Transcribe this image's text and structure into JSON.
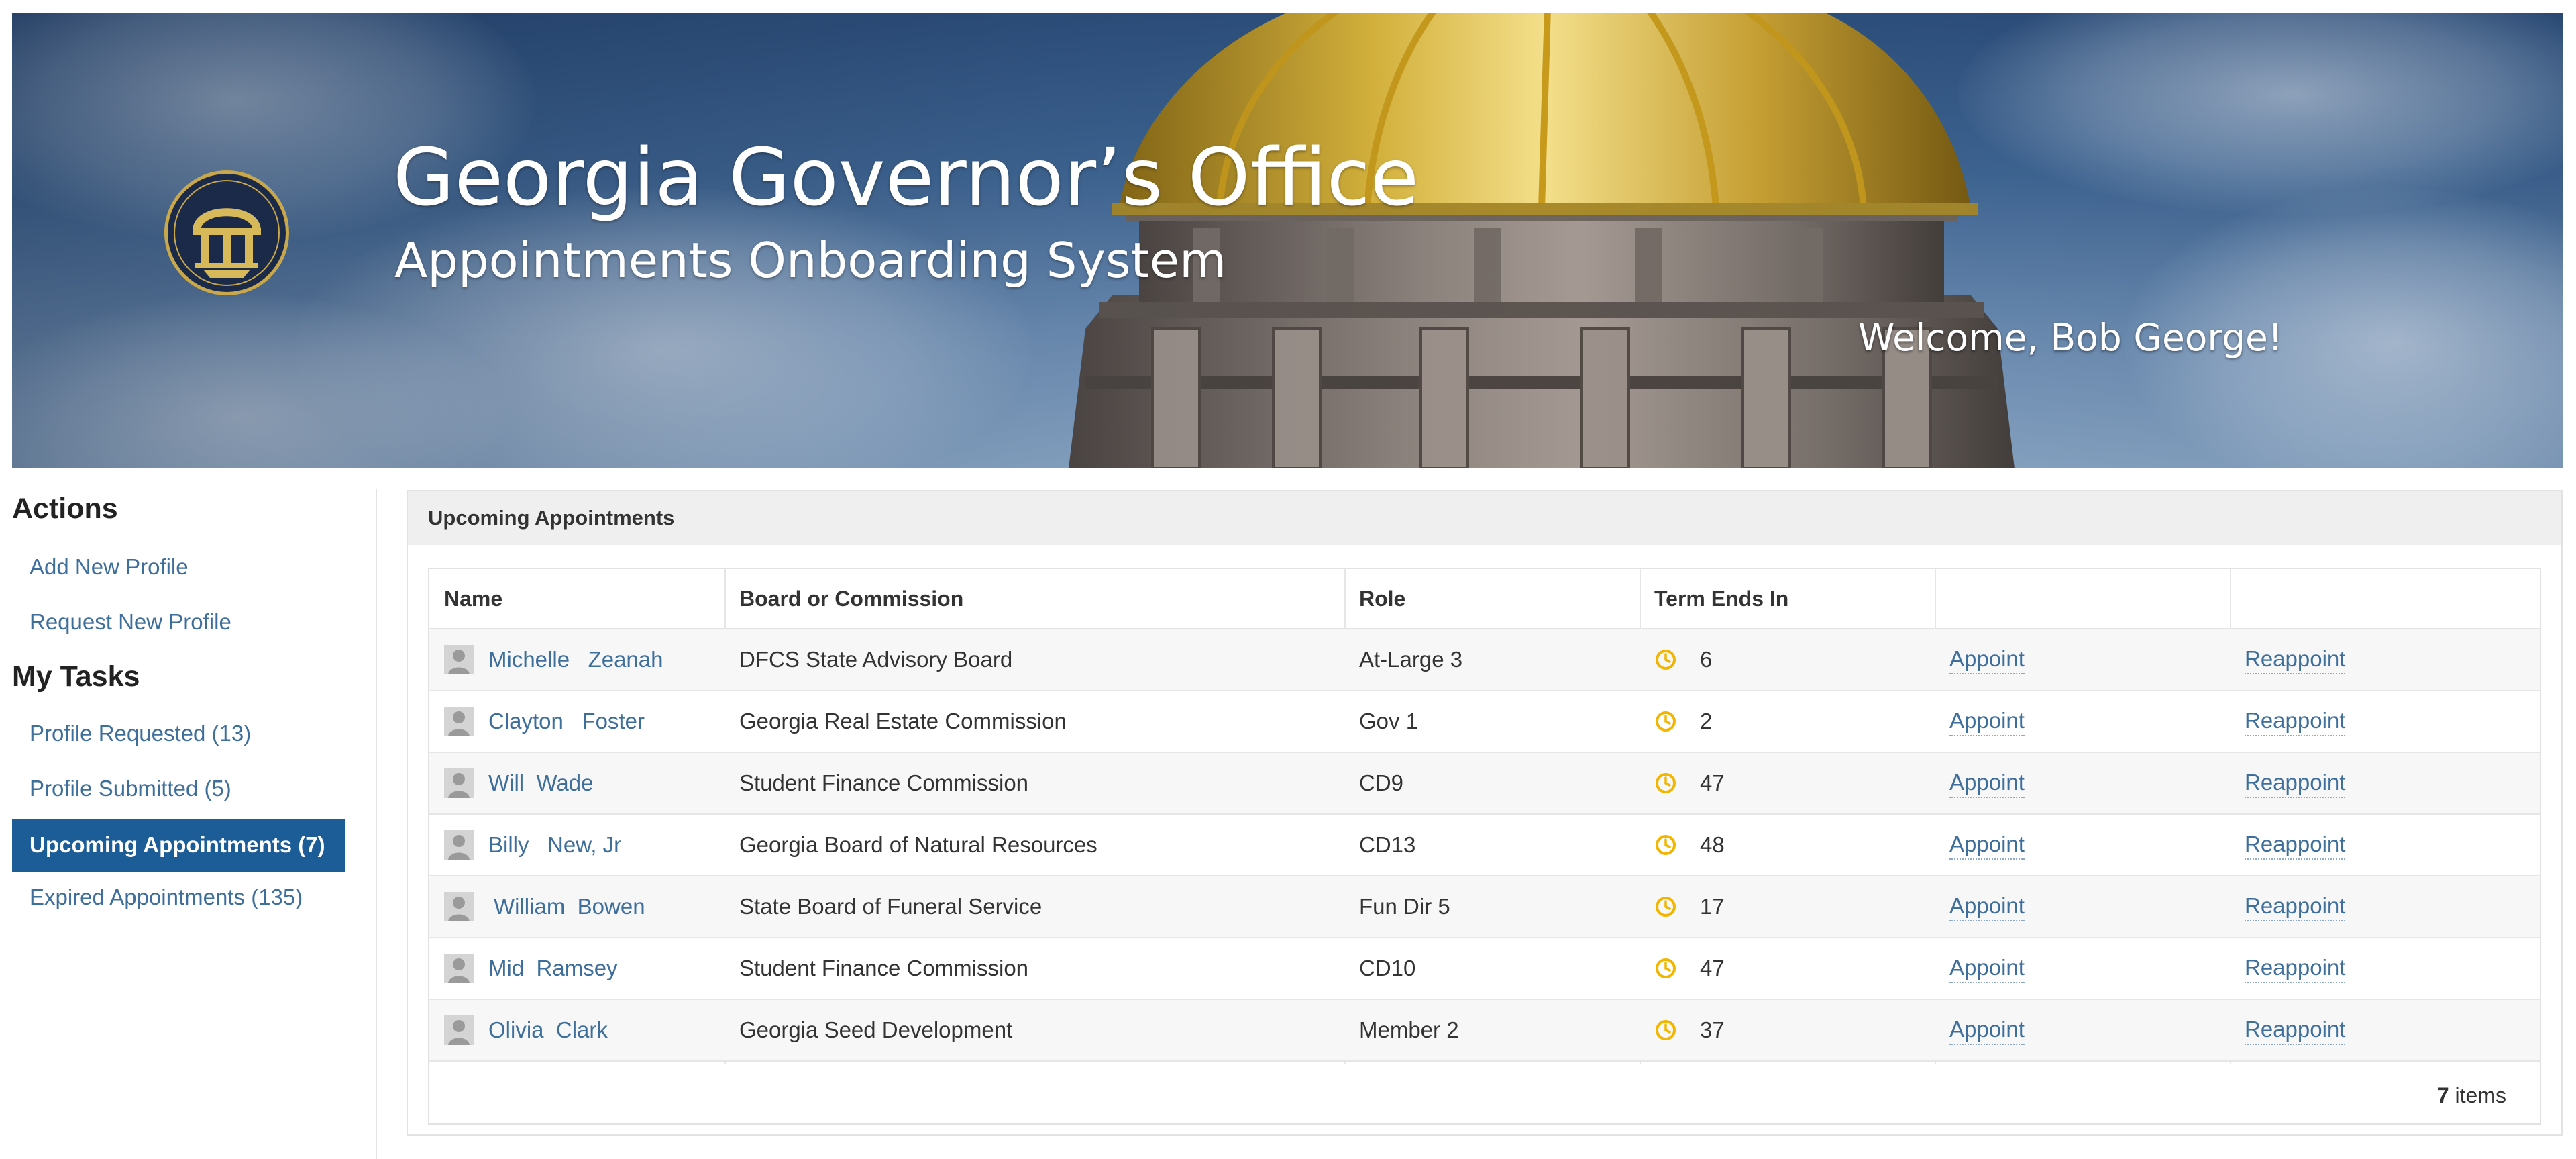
{
  "banner": {
    "title": "Georgia Governor’s Office",
    "subtitle": "Appointments Onboarding System",
    "welcome": "Welcome, Bob George!"
  },
  "sidebar": {
    "actions_heading": "Actions",
    "actions": [
      {
        "label": "Add New Profile"
      },
      {
        "label": "Request New Profile"
      }
    ],
    "tasks_heading": "My Tasks",
    "tasks": [
      {
        "label": "Profile Requested (13)",
        "active": false
      },
      {
        "label": "Profile Submitted (5)",
        "active": false
      },
      {
        "label": "Upcoming Appointments (7)",
        "active": true
      },
      {
        "label": "Expired Appointments (135)",
        "active": false
      }
    ]
  },
  "panel": {
    "title": "Upcoming Appointments",
    "columns": [
      "Name",
      "Board or Commission",
      "Role",
      "Term Ends In",
      "",
      ""
    ],
    "rows": [
      {
        "first": "Michelle",
        "last": "Zeanah",
        "board": "DFCS State Advisory Board",
        "role": "At-Large 3",
        "term": "6",
        "appoint": "Appoint",
        "reappoint": "Reappoint"
      },
      {
        "first": "Clayton",
        "last": "Foster",
        "board": "Georgia Real Estate Commission",
        "role": "Gov 1",
        "term": "2",
        "appoint": "Appoint",
        "reappoint": "Reappoint"
      },
      {
        "first": "Will",
        "last": "Wade",
        "board": "Student Finance Commission",
        "role": "CD9",
        "term": "47",
        "appoint": "Appoint",
        "reappoint": "Reappoint"
      },
      {
        "first": "Billy",
        "last": "New, Jr",
        "board": "Georgia Board of Natural Resources",
        "role": "CD13",
        "term": "48",
        "appoint": "Appoint",
        "reappoint": "Reappoint"
      },
      {
        "first": "William",
        "last": "Bowen",
        "board": "State Board of Funeral Service",
        "role": "Fun Dir 5",
        "term": "17",
        "appoint": "Appoint",
        "reappoint": "Reappoint"
      },
      {
        "first": "Mid",
        "last": "Ramsey",
        "board": "Student Finance Commission",
        "role": "CD10",
        "term": "47",
        "appoint": "Appoint",
        "reappoint": "Reappoint"
      },
      {
        "first": "Olivia",
        "last": "Clark",
        "board": "Georgia Seed Development",
        "role": "Member 2",
        "term": "37",
        "appoint": "Appoint",
        "reappoint": "Reappoint"
      }
    ],
    "footer": {
      "count": "7",
      "count_label": " items"
    }
  },
  "icons": {
    "seal": "georgia-seal-icon",
    "person": "person-icon",
    "clock": "clock-icon"
  },
  "colors": {
    "link": "#3e6f9c",
    "active_nav": "#1d5d97",
    "clock": "#f2b600",
    "header_bg": "#efefef",
    "row_alt": "#f7f7f7"
  }
}
